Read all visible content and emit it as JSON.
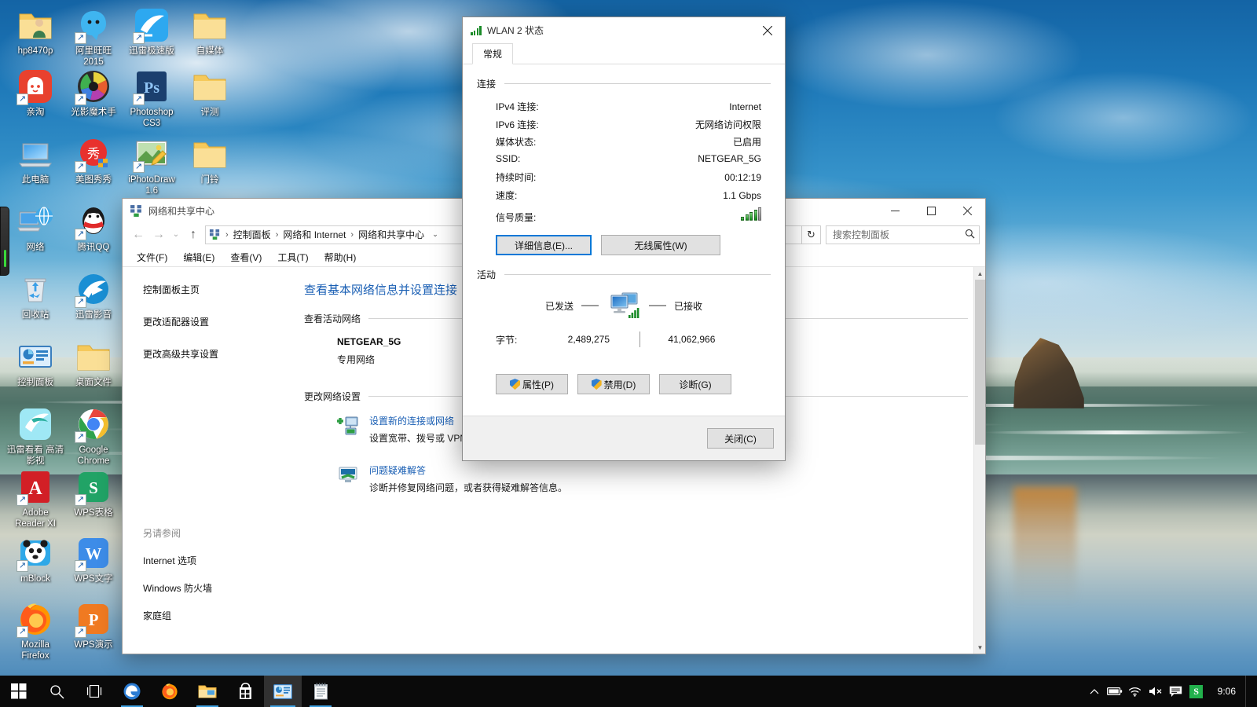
{
  "desktop": {
    "icons": [
      {
        "label": "hp8470p",
        "icon": "user-folder-icon",
        "shortcut": false,
        "col": 0,
        "row": 0
      },
      {
        "label": "阿里旺旺\n2015",
        "icon": "aliwangwang-icon",
        "shortcut": true,
        "col": 1,
        "row": 0
      },
      {
        "label": "迅雷极速版",
        "icon": "xunlei-icon",
        "shortcut": true,
        "col": 2,
        "row": 0
      },
      {
        "label": "自媒体",
        "icon": "folder-icon",
        "shortcut": false,
        "col": 3,
        "row": 0
      },
      {
        "label": "亲淘",
        "icon": "qintao-icon",
        "shortcut": true,
        "col": 0,
        "row": 1
      },
      {
        "label": "光影魔术手",
        "icon": "neoimaging-icon",
        "shortcut": true,
        "col": 1,
        "row": 1
      },
      {
        "label": "Photoshop\nCS3",
        "icon": "photoshop-icon",
        "shortcut": true,
        "col": 2,
        "row": 1
      },
      {
        "label": "评测",
        "icon": "folder-icon",
        "shortcut": false,
        "col": 3,
        "row": 1
      },
      {
        "label": "此电脑",
        "icon": "this-pc-icon",
        "shortcut": false,
        "col": 0,
        "row": 2
      },
      {
        "label": "美图秀秀",
        "icon": "meitu-icon",
        "shortcut": true,
        "col": 1,
        "row": 2
      },
      {
        "label": "iPhotoDraw\n1.6",
        "icon": "iphotodraw-icon",
        "shortcut": true,
        "col": 2,
        "row": 2
      },
      {
        "label": "门铃",
        "icon": "folder-icon",
        "shortcut": false,
        "col": 3,
        "row": 2
      },
      {
        "label": "网络",
        "icon": "network-icon",
        "shortcut": false,
        "col": 0,
        "row": 3
      },
      {
        "label": "腾讯QQ",
        "icon": "qq-icon",
        "shortcut": true,
        "col": 1,
        "row": 3
      },
      {
        "label": "回收站",
        "icon": "recycle-bin-icon",
        "shortcut": false,
        "col": 0,
        "row": 4
      },
      {
        "label": "迅雷影音",
        "icon": "xunlei-player-icon",
        "shortcut": true,
        "col": 1,
        "row": 4
      },
      {
        "label": "控制面板",
        "icon": "control-panel-icon",
        "shortcut": false,
        "col": 0,
        "row": 5
      },
      {
        "label": "桌面文件",
        "icon": "folder-icon",
        "shortcut": false,
        "col": 1,
        "row": 5
      },
      {
        "label": "迅雷看看\n高清影视",
        "icon": "xunlei-kankan-icon",
        "shortcut": false,
        "col": 0,
        "row": 6
      },
      {
        "label": "Google\nChrome",
        "icon": "chrome-icon",
        "shortcut": true,
        "col": 1,
        "row": 6
      },
      {
        "label": "Adobe\nReader XI",
        "icon": "adobe-reader-icon",
        "shortcut": true,
        "col": 0,
        "row": 7
      },
      {
        "label": "WPS表格",
        "icon": "wps-spreadsheet-icon",
        "shortcut": true,
        "col": 1,
        "row": 7
      },
      {
        "label": "mBlock",
        "icon": "mblock-icon",
        "shortcut": true,
        "col": 0,
        "row": 8
      },
      {
        "label": "WPS文字",
        "icon": "wps-writer-icon",
        "shortcut": true,
        "col": 1,
        "row": 8
      },
      {
        "label": "Mozilla\nFirefox",
        "icon": "firefox-icon",
        "shortcut": true,
        "col": 0,
        "row": 9
      },
      {
        "label": "WPS演示",
        "icon": "wps-presentation-icon",
        "shortcut": true,
        "col": 1,
        "row": 9
      }
    ]
  },
  "explorer": {
    "title": "网络和共享中心",
    "title_icon": "network-sharing-icon",
    "window_buttons": {
      "minimize": "—",
      "maximize": "▢",
      "close": "✕"
    },
    "nav": {
      "back": "←",
      "forward": "→",
      "history": "⌄",
      "up": "↑"
    },
    "breadcrumb": {
      "icon": "network-sharing-icon",
      "items": [
        "控制面板",
        "网络和 Internet",
        "网络和共享中心"
      ],
      "separator": "›",
      "dropdown": "⌄"
    },
    "refresh_icon": "↻",
    "search": {
      "placeholder": "搜索控制面板",
      "value": "",
      "icon": "search-icon"
    },
    "menu": [
      "文件(F)",
      "编辑(E)",
      "查看(V)",
      "工具(T)",
      "帮助(H)"
    ],
    "left_links": [
      "控制面板主页",
      "更改适配器设置",
      "更改高级共享设置"
    ],
    "see_also": {
      "header": "另请参阅",
      "links": [
        "Internet 选项",
        "Windows 防火墙",
        "家庭组"
      ]
    },
    "main": {
      "heading": "查看基本网络信息并设置连接",
      "section_active": "查看活动网络",
      "network_name": "NETGEAR_5G",
      "network_type": "专用网络",
      "section_change": "更改网络设置",
      "tasks": [
        {
          "icon": "new-connection-icon",
          "link": "设置新的连接或网络",
          "desc": "设置宽带、拨号或 VPN 连接；或设置路由器或访问点。"
        },
        {
          "icon": "troubleshoot-icon",
          "link": "问题疑难解答",
          "desc": "诊断并修复网络问题，或者获得疑难解答信息。"
        }
      ]
    }
  },
  "wlan_dialog": {
    "title": "WLAN 2 状态",
    "title_icon": "wifi-signal-icon",
    "close_icon": "✕",
    "tab": "常规",
    "connection": {
      "group_label": "连接",
      "rows": [
        {
          "key": "IPv4 连接:",
          "value": "Internet"
        },
        {
          "key": "IPv6 连接:",
          "value": "无网络访问权限"
        },
        {
          "key": "媒体状态:",
          "value": "已启用"
        },
        {
          "key": "SSID:",
          "value": "NETGEAR_5G"
        },
        {
          "key": "持续时间:",
          "value": "00:12:19"
        },
        {
          "key": "速度:",
          "value": "1.1 Gbps"
        }
      ],
      "signal_label": "信号质量:",
      "signal_bars_filled": 4,
      "signal_bars_total": 5
    },
    "buttons": {
      "details": "详细信息(E)...",
      "wireless_props": "无线属性(W)"
    },
    "activity": {
      "group_label": "活动",
      "sent_label": "已发送",
      "received_label": "已接收",
      "icon": "two-monitors-icon",
      "bytes_label": "字节:",
      "bytes_sent": "2,489,275",
      "bytes_received": "41,062,966"
    },
    "bottom_buttons": [
      {
        "label": "属性(P)",
        "shield": true,
        "name": "properties-button"
      },
      {
        "label": "禁用(D)",
        "shield": true,
        "name": "disable-button"
      },
      {
        "label": "诊断(G)",
        "shield": false,
        "name": "diagnose-button"
      }
    ],
    "close_button": "关闭(C)"
  },
  "taskbar": {
    "items": [
      {
        "name": "start-button",
        "icon": "windows-logo-icon"
      },
      {
        "name": "search-button",
        "icon": "search-icon"
      },
      {
        "name": "task-view-button",
        "icon": "task-view-icon"
      },
      {
        "name": "edge-button",
        "icon": "edge-icon",
        "open": true
      },
      {
        "name": "firefox-button",
        "icon": "firefox-icon",
        "open": false
      },
      {
        "name": "file-explorer-button",
        "icon": "file-explorer-icon",
        "open": true
      },
      {
        "name": "store-button",
        "icon": "store-icon",
        "open": false
      },
      {
        "name": "control-panel-button",
        "icon": "control-panel-icon",
        "active": true
      },
      {
        "name": "notepad-button",
        "icon": "notepad-icon",
        "open": true
      }
    ],
    "tray": [
      {
        "name": "show-hidden-icons",
        "icon": "chevron-up-icon",
        "glyph": "⌃"
      },
      {
        "name": "battery-icon",
        "icon": "battery-icon",
        "glyph": ""
      },
      {
        "name": "network-icon",
        "icon": "wifi-icon",
        "glyph": ""
      },
      {
        "name": "volume-icon",
        "icon": "speaker-muted-icon",
        "glyph": ""
      },
      {
        "name": "action-center-icon",
        "icon": "action-center-icon",
        "glyph": ""
      },
      {
        "name": "ime-icon",
        "icon": "sogou-ime-icon",
        "glyph": "S"
      }
    ],
    "clock": "9:06"
  },
  "colors": {
    "accent": "#0078d7",
    "link": "#1a5fb4",
    "taskbar_bg": "#0a0a0a",
    "signal_green": "#0f8b18",
    "ime_green": "#22b14c"
  }
}
